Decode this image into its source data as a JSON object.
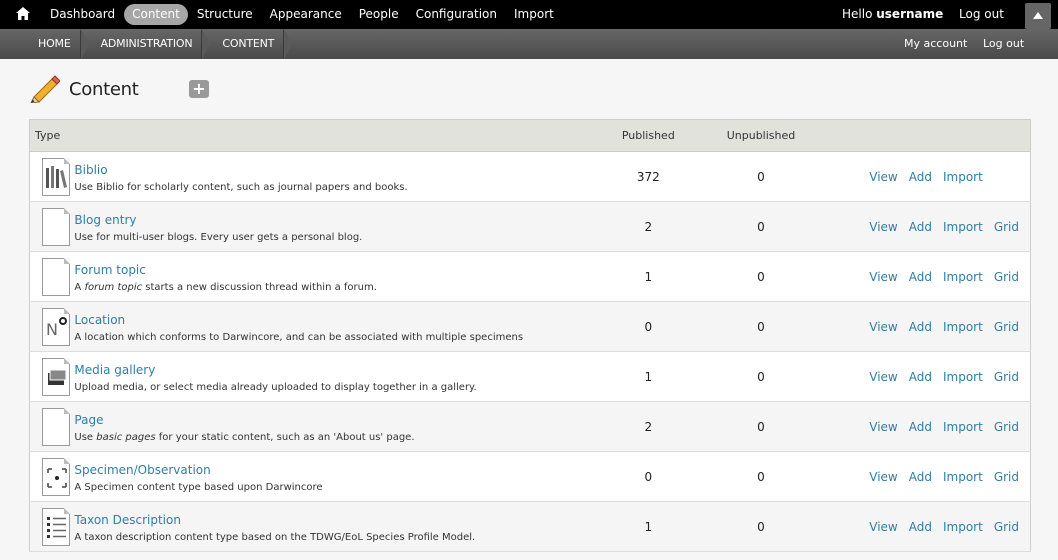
{
  "toolbar": {
    "menu": [
      "Dashboard",
      "Content",
      "Structure",
      "Appearance",
      "People",
      "Configuration",
      "Import"
    ],
    "active_index": 1,
    "hello_prefix": "Hello",
    "username": "username",
    "logout": "Log out"
  },
  "shortcuts": {
    "breadcrumb": [
      "HOME",
      "ADMINISTRATION",
      "CONTENT"
    ],
    "my_account": "My account",
    "logout": "Log out"
  },
  "page": {
    "title": "Content",
    "add_symbol": "+"
  },
  "table": {
    "headers": {
      "type": "Type",
      "published": "Published",
      "unpublished": "Unpublished"
    },
    "rows": [
      {
        "name": "Biblio",
        "desc_html": "Use Biblio for scholarly content, such as journal papers and books.",
        "published": "372",
        "unpublished": "0",
        "ops": [
          "View",
          "Add",
          "Import"
        ],
        "icon": "biblio-icon"
      },
      {
        "name": "Blog entry",
        "desc_html": "Use for multi-user blogs. Every user gets a personal blog.",
        "published": "2",
        "unpublished": "0",
        "ops": [
          "View",
          "Add",
          "Import",
          "Grid"
        ],
        "icon": "document-icon"
      },
      {
        "name": "Forum topic",
        "desc_html": "A <i>forum topic</i> starts a new discussion thread within a forum.",
        "published": "1",
        "unpublished": "0",
        "ops": [
          "View",
          "Add",
          "Import",
          "Grid"
        ],
        "icon": "document-icon"
      },
      {
        "name": "Location",
        "desc_html": "A location which conforms to Darwincore, and can be associated with multiple specimens",
        "published": "0",
        "unpublished": "0",
        "ops": [
          "View",
          "Add",
          "Import",
          "Grid"
        ],
        "icon": "location-icon"
      },
      {
        "name": "Media gallery",
        "desc_html": "Upload media, or select media already uploaded to display together in a gallery.",
        "published": "1",
        "unpublished": "0",
        "ops": [
          "View",
          "Add",
          "Import",
          "Grid"
        ],
        "icon": "gallery-icon"
      },
      {
        "name": "Page",
        "desc_html": "Use <i>basic pages</i> for your static content, such as an 'About us' page.",
        "published": "2",
        "unpublished": "0",
        "ops": [
          "View",
          "Add",
          "Import",
          "Grid"
        ],
        "icon": "document-icon"
      },
      {
        "name": "Specimen/Observation",
        "desc_html": "A Specimen content type based upon Darwincore",
        "published": "0",
        "unpublished": "0",
        "ops": [
          "View",
          "Add",
          "Import",
          "Grid"
        ],
        "icon": "specimen-icon"
      },
      {
        "name": "Taxon Description",
        "desc_html": "A taxon description content type based on the TDWG/EoL Species Profile Model.",
        "published": "1",
        "unpublished": "0",
        "ops": [
          "View",
          "Add",
          "Import",
          "Grid"
        ],
        "icon": "taxon-icon"
      }
    ]
  },
  "colors": {
    "link": "#2f7fa3",
    "toolbar_bg": "#000000",
    "active_pill": "#a6a6a6"
  }
}
